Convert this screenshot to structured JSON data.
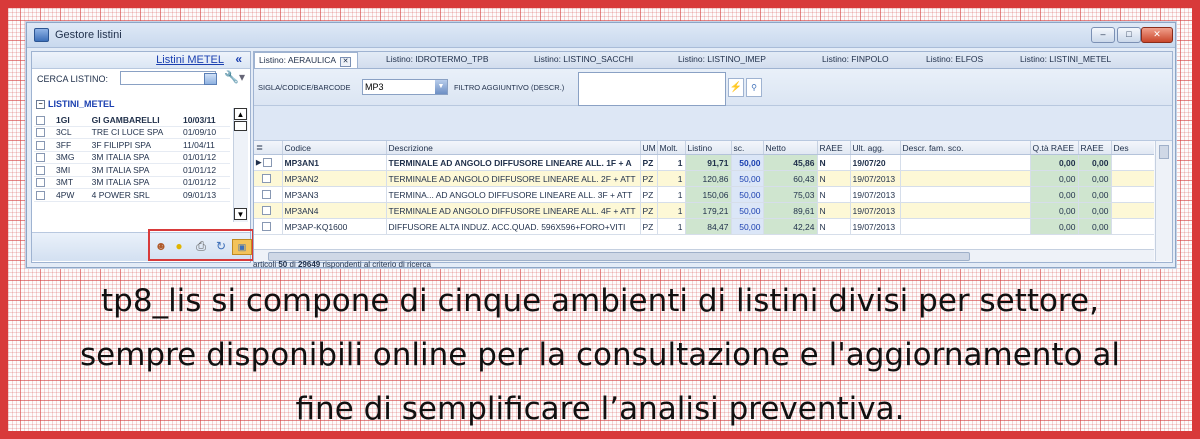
{
  "window": {
    "title": "Gestore listini",
    "buttons": {
      "minimize": "–",
      "maximize": "□",
      "close": "✕"
    }
  },
  "left_panel": {
    "link": "Listini METEL",
    "collapse": "«",
    "search_label": "CERCA LISTINO:",
    "search_value": "",
    "group": "LISTINI_METEL",
    "rows": [
      {
        "code": "1GI",
        "name": "GI GAMBARELLI",
        "date": "10/03/11",
        "bold": true
      },
      {
        "code": "3CL",
        "name": "TRE CI LUCE SPA",
        "date": "01/09/10"
      },
      {
        "code": "3FF",
        "name": "3F FILIPPI SPA",
        "date": "11/04/11"
      },
      {
        "code": "3MG",
        "name": "3M ITALIA SPA",
        "date": "01/01/12"
      },
      {
        "code": "3MI",
        "name": "3M ITALIA SPA",
        "date": "01/01/12"
      },
      {
        "code": "3MT",
        "name": "3M ITALIA SPA",
        "date": "01/01/12"
      },
      {
        "code": "4PW",
        "name": "4 POWER SRL",
        "date": "09/01/13"
      }
    ],
    "tools": [
      "user-icon",
      "bulb-icon",
      "printer-icon",
      "sync-icon",
      "card-icon"
    ]
  },
  "tabs": [
    {
      "label": "Listino: AERAULICA",
      "active": true
    },
    {
      "label": "Listino: IDROTERMO_TPB"
    },
    {
      "label": "Listino: LISTINO_SACCHI"
    },
    {
      "label": "Listino: LISTINO_IMEP"
    },
    {
      "label": "Listino: FINPOLO"
    },
    {
      "label": "Listino: ELFOS"
    },
    {
      "label": "Listino: LISTINI_METEL"
    }
  ],
  "filter": {
    "code_label": "SIGLA/CODICE/BARCODE",
    "code_value": "MP3",
    "extra_label": "FILTRO AGGIUNTIVO (DESCR.)",
    "extra_value": ""
  },
  "grid": {
    "headers": [
      "",
      "Codice",
      "Descrizione",
      "UM",
      "Molt.",
      "Listino",
      "sc.",
      "Netto",
      "RAEE",
      "Ult. agg.",
      "Descr. fam. sco.",
      "Q.tà RAEE",
      "RAEE",
      "Des"
    ],
    "rows": [
      {
        "code": "MP3AN1",
        "desc": "TERMINALE AD ANGOLO DIFFUSORE LINEARE ALL. 1F + A",
        "um": "PZ",
        "molt": "1",
        "listino": "91,71",
        "sc": "50,00",
        "netto": "45,86",
        "raee": "N",
        "date": "19/07/20",
        "fam": "",
        "qraee": "0,00",
        "raee2": "0,00",
        "style": "cur"
      },
      {
        "code": "MP3AN2",
        "desc": "TERMINALE AD ANGOLO DIFFUSORE LINEARE ALL. 2F + ATT",
        "um": "PZ",
        "molt": "1",
        "listino": "120,86",
        "sc": "50,00",
        "netto": "60,43",
        "raee": "N",
        "date": "19/07/2013",
        "fam": "",
        "qraee": "0,00",
        "raee2": "0,00",
        "style": "y"
      },
      {
        "code": "MP3AN3",
        "desc": "TERMINA... AD ANGOLO DIFFUSORE LINEARE ALL. 3F + ATT",
        "um": "PZ",
        "molt": "1",
        "listino": "150,06",
        "sc": "50,00",
        "netto": "75,03",
        "raee": "N",
        "date": "19/07/2013",
        "fam": "",
        "qraee": "0,00",
        "raee2": "0,00",
        "style": "w"
      },
      {
        "code": "MP3AN4",
        "desc": "TERMINALE AD ANGOLO DIFFUSORE LINEARE ALL. 4F + ATT",
        "um": "PZ",
        "molt": "1",
        "listino": "179,21",
        "sc": "50,00",
        "netto": "89,61",
        "raee": "N",
        "date": "19/07/2013",
        "fam": "",
        "qraee": "0,00",
        "raee2": "0,00",
        "style": "y"
      },
      {
        "code": "MP3AP-KQ1600",
        "desc": "DIFFUSORE ALTA INDUZ. ACC.QUAD. 596X596+FORO+VITI",
        "um": "PZ",
        "molt": "1",
        "listino": "84,47",
        "sc": "50,00",
        "netto": "42,24",
        "raee": "N",
        "date": "19/07/2013",
        "fam": "",
        "qraee": "0,00",
        "raee2": "0,00",
        "style": "w"
      }
    ]
  },
  "status": {
    "prefix": "articoli",
    "count": "50",
    "middle": "di",
    "total": "29649",
    "suffix": "rispondenti al criterio di ricerca"
  },
  "caption": [
    "tp8_lis si compone di cinque ambienti di listini divisi per settore,",
    "sempre disponibili online per la consultazione e l'aggiornamento al",
    "fine di semplificare l’analisi preventiva."
  ],
  "colors": {
    "frame": "#d83a3a",
    "link": "#1a3fb0",
    "highlight_row": "#fdf8d6",
    "price_cell": "#cfe5cf"
  }
}
